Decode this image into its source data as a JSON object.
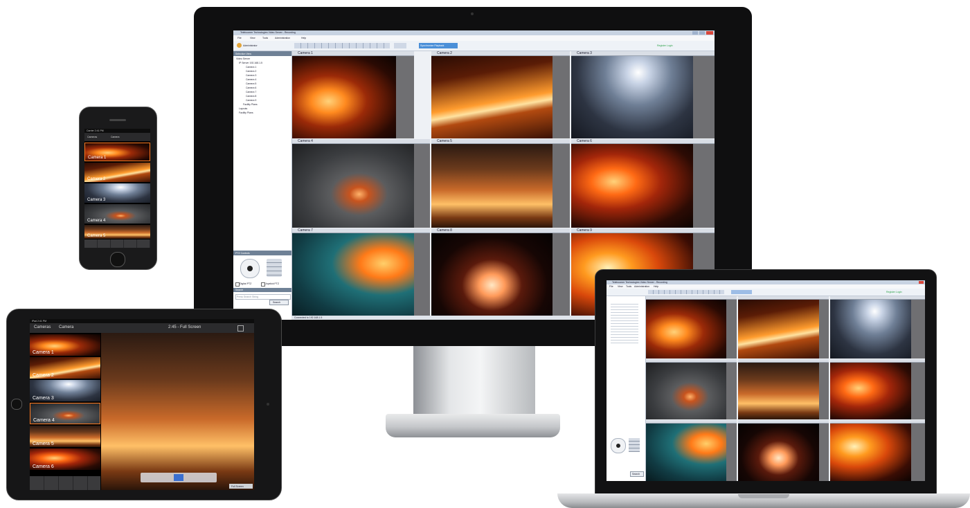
{
  "desktop": {
    "window_title": "Teleboomer Technologies Video Server - Recording",
    "menu": [
      "File",
      "View",
      "Tools",
      "Administration",
      "Help"
    ],
    "user": "Administrator",
    "toolbar_btn": "Synchronize Playback",
    "right_link": "Register Login",
    "sidebar_title": "Selection View",
    "tree": [
      "Video Server",
      "IP Server 192.168.1.5",
      "Camera 1",
      "Camera 2",
      "Camera 3",
      "Camera 4",
      "Camera 5",
      "Camera 6",
      "Camera 7",
      "Camera 8",
      "Camera 9",
      "Facility Plans",
      "Layouts",
      "Facility Plans"
    ],
    "cameras": [
      "Camera 1",
      "Camera 2",
      "Camera 3",
      "Camera 4",
      "Camera 5",
      "Camera 6",
      "Camera 7",
      "Camera 8",
      "Camera 9"
    ],
    "ptz_title": "PTZ Controls",
    "ptz_check1": "Digital PTZ",
    "ptz_check2": "Joystick PTZ",
    "search_title": "Search",
    "search_placeholder": "Press Search String",
    "search_btn": "Search",
    "status": "Connected to 192.168.1.5"
  },
  "phone": {
    "status": "Carrier  2:41 PM",
    "back": "Cameras",
    "tab": "Camera",
    "cams": [
      "Camera 1",
      "Camera 2",
      "Camera 3",
      "Camera 4",
      "Camera 5"
    ]
  },
  "tablet": {
    "status": "iPad  2:41 PM",
    "back": "Cameras",
    "title": "Camera",
    "time": "2:45 - Full Screen",
    "cams": [
      "Camera 1",
      "Camera 2",
      "Camera 3",
      "Camera 4",
      "Camera 5",
      "Camera 6"
    ],
    "corner_btn": "Full Screen"
  },
  "laptop": {
    "window_title": "Teleboomer Technologies Video Server - Recording",
    "menu": [
      "File",
      "View",
      "Tools",
      "Administration",
      "Help"
    ],
    "right_link": "Register Login",
    "search_btn": "Search"
  },
  "colors": {
    "accent": "#4a8fd8",
    "link_green": "#2fa34a",
    "bezel": "#141414"
  }
}
